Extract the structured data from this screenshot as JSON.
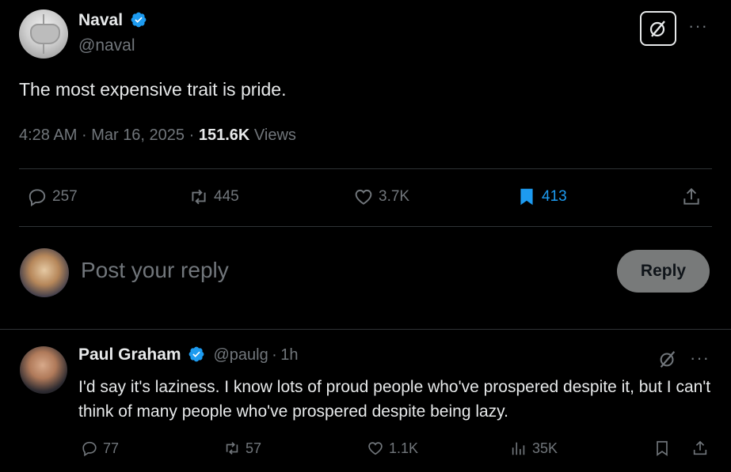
{
  "tweet": {
    "author_name": "Naval",
    "author_handle": "@naval",
    "text": "The most expensive trait is pride.",
    "time": "4:28 AM",
    "date": "Mar 16, 2025",
    "views_count": "151.6K",
    "views_label": "Views",
    "separator": "·",
    "more_label": "···",
    "stats": {
      "replies": "257",
      "reposts": "445",
      "likes": "3.7K",
      "bookmarks": "413"
    }
  },
  "composer": {
    "placeholder": "Post your reply",
    "button_label": "Reply"
  },
  "reply": {
    "author_name": "Paul Graham",
    "author_handle": "@paulg",
    "time_sep": "·",
    "time": "1h",
    "text": "I'd say it's laziness. I know lots of proud people who've prospered despite it, but I can't think of many people who've prospered despite being lazy.",
    "more_label": "···",
    "stats": {
      "replies": "77",
      "reposts": "57",
      "likes": "1.1K",
      "views": "35K"
    }
  },
  "colors": {
    "background": "#000000",
    "verified": "#1d9bf0",
    "bookmark_active": "#1d9bf0",
    "muted": "#71767b",
    "reply_button": "#787a7a"
  }
}
